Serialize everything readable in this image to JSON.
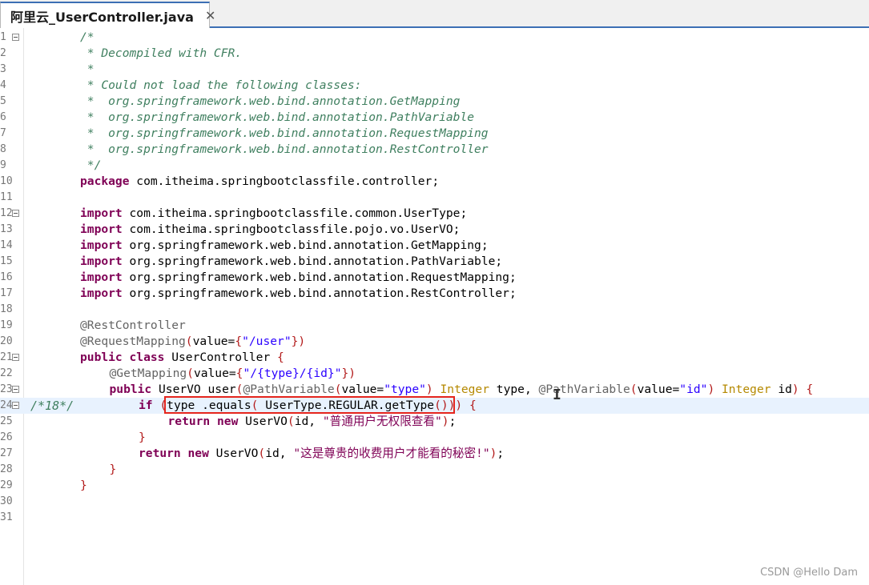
{
  "tab": {
    "title": "阿里云_UserController.java",
    "close_glyph": "✕"
  },
  "editor": {
    "lines": [
      {
        "n": "1",
        "fold": true,
        "marker": "",
        "indent": 0,
        "tokens": [
          {
            "t": "/*",
            "c": "c"
          }
        ]
      },
      {
        "n": "2",
        "fold": false,
        "marker": "",
        "indent": 0,
        "tokens": [
          {
            "t": " * Decompiled with CFR.",
            "c": "c"
          }
        ]
      },
      {
        "n": "3",
        "fold": false,
        "marker": "",
        "indent": 0,
        "tokens": [
          {
            "t": " *",
            "c": "c"
          }
        ]
      },
      {
        "n": "4",
        "fold": false,
        "marker": "",
        "indent": 0,
        "tokens": [
          {
            "t": " * Could not load the following classes:",
            "c": "c"
          }
        ]
      },
      {
        "n": "5",
        "fold": false,
        "marker": "",
        "indent": 0,
        "tokens": [
          {
            "t": " *  org.springframework.web.bind.annotation.GetMapping",
            "c": "c"
          }
        ]
      },
      {
        "n": "6",
        "fold": false,
        "marker": "",
        "indent": 0,
        "tokens": [
          {
            "t": " *  org.springframework.web.bind.annotation.PathVariable",
            "c": "c"
          }
        ]
      },
      {
        "n": "7",
        "fold": false,
        "marker": "",
        "indent": 0,
        "tokens": [
          {
            "t": " *  org.springframework.web.bind.annotation.RequestMapping",
            "c": "c"
          }
        ]
      },
      {
        "n": "8",
        "fold": false,
        "marker": "",
        "indent": 0,
        "tokens": [
          {
            "t": " *  org.springframework.web.bind.annotation.RestController",
            "c": "c"
          }
        ]
      },
      {
        "n": "9",
        "fold": false,
        "marker": "",
        "indent": 0,
        "tokens": [
          {
            "t": " */",
            "c": "c"
          }
        ]
      },
      {
        "n": "10",
        "fold": false,
        "marker": "",
        "indent": 0,
        "tokens": [
          {
            "t": "package",
            "c": "k"
          },
          {
            "t": " com.itheima.springbootclassfile.controller;",
            "c": ""
          }
        ]
      },
      {
        "n": "11",
        "fold": false,
        "marker": "",
        "indent": 0,
        "tokens": []
      },
      {
        "n": "12",
        "fold": true,
        "marker": "",
        "indent": 0,
        "tokens": [
          {
            "t": "import",
            "c": "k"
          },
          {
            "t": " com.itheima.springbootclassfile.common.UserType;",
            "c": ""
          }
        ]
      },
      {
        "n": "13",
        "fold": false,
        "marker": "",
        "indent": 0,
        "tokens": [
          {
            "t": "import",
            "c": "k"
          },
          {
            "t": " com.itheima.springbootclassfile.pojo.vo.UserVO;",
            "c": ""
          }
        ]
      },
      {
        "n": "14",
        "fold": false,
        "marker": "",
        "indent": 0,
        "tokens": [
          {
            "t": "import",
            "c": "k"
          },
          {
            "t": " org.springframework.web.bind.annotation.GetMapping;",
            "c": ""
          }
        ]
      },
      {
        "n": "15",
        "fold": false,
        "marker": "",
        "indent": 0,
        "tokens": [
          {
            "t": "import",
            "c": "k"
          },
          {
            "t": " org.springframework.web.bind.annotation.PathVariable;",
            "c": ""
          }
        ]
      },
      {
        "n": "16",
        "fold": false,
        "marker": "",
        "indent": 0,
        "tokens": [
          {
            "t": "import",
            "c": "k"
          },
          {
            "t": " org.springframework.web.bind.annotation.RequestMapping;",
            "c": ""
          }
        ]
      },
      {
        "n": "17",
        "fold": false,
        "marker": "",
        "indent": 0,
        "tokens": [
          {
            "t": "import",
            "c": "k"
          },
          {
            "t": " org.springframework.web.bind.annotation.RestController;",
            "c": ""
          }
        ]
      },
      {
        "n": "18",
        "fold": false,
        "marker": "",
        "indent": 0,
        "tokens": []
      },
      {
        "n": "19",
        "fold": false,
        "marker": "",
        "indent": 0,
        "tokens": [
          {
            "t": "@RestController",
            "c": "a"
          }
        ]
      },
      {
        "n": "20",
        "fold": false,
        "marker": "",
        "indent": 0,
        "tokens": [
          {
            "t": "@RequestMapping",
            "c": "a"
          },
          {
            "t": "(",
            "c": "p"
          },
          {
            "t": "value=",
            "c": ""
          },
          {
            "t": "{",
            "c": "p"
          },
          {
            "t": "\"/user\"",
            "c": "s"
          },
          {
            "t": "})",
            "c": "p"
          }
        ]
      },
      {
        "n": "21",
        "fold": true,
        "marker": "",
        "indent": 0,
        "tokens": [
          {
            "t": "public class",
            "c": "k"
          },
          {
            "t": " UserController ",
            "c": ""
          },
          {
            "t": "{",
            "c": "p"
          }
        ]
      },
      {
        "n": "22",
        "fold": false,
        "marker": "",
        "indent": 1,
        "tokens": [
          {
            "t": "@GetMapping",
            "c": "a"
          },
          {
            "t": "(",
            "c": "p"
          },
          {
            "t": "value=",
            "c": ""
          },
          {
            "t": "{",
            "c": "p"
          },
          {
            "t": "\"/{type}/{id}\"",
            "c": "s"
          },
          {
            "t": "})",
            "c": "p"
          }
        ]
      },
      {
        "n": "23",
        "fold": true,
        "marker": "",
        "indent": 1,
        "tokens": [
          {
            "t": "public",
            "c": "k"
          },
          {
            "t": " UserVO user",
            "c": ""
          },
          {
            "t": "(",
            "c": "p"
          },
          {
            "t": "@PathVariable",
            "c": "a"
          },
          {
            "t": "(",
            "c": "p"
          },
          {
            "t": "value=",
            "c": ""
          },
          {
            "t": "\"type\"",
            "c": "s"
          },
          {
            "t": ")",
            "c": "p"
          },
          {
            "t": " Integer",
            "c": "t"
          },
          {
            "t": " type, ",
            "c": ""
          },
          {
            "t": "@PathVariable",
            "c": "a"
          },
          {
            "t": "(",
            "c": "p"
          },
          {
            "t": "value=",
            "c": ""
          },
          {
            "t": "\"id\"",
            "c": "s"
          },
          {
            "t": ")",
            "c": "p"
          },
          {
            "t": " Integer",
            "c": "t"
          },
          {
            "t": " id",
            "c": ""
          },
          {
            "t": ")",
            "c": "p"
          },
          {
            "t": " ",
            "c": ""
          },
          {
            "t": "{",
            "c": "p"
          }
        ]
      },
      {
        "n": "24",
        "fold": true,
        "marker": "/*18*/",
        "indent": 2,
        "current": true,
        "tokens": [
          {
            "t": "if",
            "c": "k"
          },
          {
            "t": " ",
            "c": ""
          },
          {
            "t": "(",
            "c": "p"
          },
          {
            "t": "type .equals",
            "c": ""
          },
          {
            "t": "(",
            "c": "p"
          },
          {
            "t": " UserType.REGULAR.getType",
            "c": ""
          },
          {
            "t": "()))",
            "c": "p"
          },
          {
            "t": " ",
            "c": ""
          },
          {
            "t": "{",
            "c": "p"
          }
        ]
      },
      {
        "n": "25",
        "fold": false,
        "marker": "",
        "indent": 3,
        "tokens": [
          {
            "t": "return new",
            "c": "k"
          },
          {
            "t": " UserVO",
            "c": ""
          },
          {
            "t": "(",
            "c": "p"
          },
          {
            "t": "id, ",
            "c": ""
          },
          {
            "t": "\"普通用户无权限查看\"",
            "c": "ts"
          },
          {
            "t": ")",
            "c": "p"
          },
          {
            "t": ";",
            "c": ""
          }
        ]
      },
      {
        "n": "26",
        "fold": false,
        "marker": "",
        "indent": 2,
        "tokens": [
          {
            "t": "}",
            "c": "p"
          }
        ]
      },
      {
        "n": "27",
        "fold": false,
        "marker": "",
        "indent": 2,
        "tokens": [
          {
            "t": "return new",
            "c": "k"
          },
          {
            "t": " UserVO",
            "c": ""
          },
          {
            "t": "(",
            "c": "p"
          },
          {
            "t": "id, ",
            "c": ""
          },
          {
            "t": "\"这是尊贵的收费用户才能看的秘密!\"",
            "c": "ts"
          },
          {
            "t": ")",
            "c": "p"
          },
          {
            "t": ";",
            "c": ""
          }
        ]
      },
      {
        "n": "28",
        "fold": false,
        "marker": "",
        "indent": 1,
        "tokens": [
          {
            "t": "}",
            "c": "p"
          }
        ]
      },
      {
        "n": "29",
        "fold": false,
        "marker": "",
        "indent": 0,
        "tokens": [
          {
            "t": "}",
            "c": "p"
          }
        ]
      },
      {
        "n": "30",
        "fold": false,
        "marker": "",
        "indent": 0,
        "tokens": []
      },
      {
        "n": "31",
        "fold": false,
        "marker": "",
        "indent": 0,
        "tokens": []
      }
    ]
  },
  "cursor_glyph": "I",
  "watermark": "CSDN @Hello Dam",
  "colors": {
    "keyword": "#7f0055",
    "comment": "#3f7f5f",
    "string": "#2a00ff",
    "annotation": "#646464",
    "paren": "#b31b1b",
    "type": "#b58900",
    "highlight_box": "#e5251d",
    "current_line": "#e8f2fe",
    "tab_accent": "#3c6fb4"
  }
}
